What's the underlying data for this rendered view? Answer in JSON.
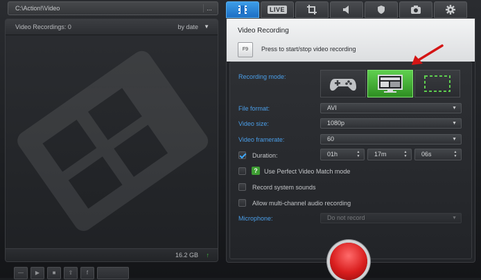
{
  "left": {
    "path": "C:\\Action!\\Video",
    "path_button": "...",
    "header_title": "Video Recordings: 0",
    "sort_label": "by date",
    "footer_size": "16.2 GB"
  },
  "tabs": [
    {
      "name": "video",
      "icon": "film-icon",
      "active": true
    },
    {
      "name": "live",
      "label": "LIVE",
      "icon": "live-icon"
    },
    {
      "name": "screenshot",
      "icon": "crop-icon"
    },
    {
      "name": "audio",
      "icon": "speaker-icon"
    },
    {
      "name": "hardware",
      "icon": "shield-icon"
    },
    {
      "name": "webcam",
      "icon": "camera-icon"
    },
    {
      "name": "settings",
      "icon": "gear-icon"
    }
  ],
  "panel": {
    "title": "Video Recording",
    "hotkey": "F9",
    "hint": "Press to start/stop video recording"
  },
  "recording": {
    "mode_label": "Recording mode:",
    "modes": [
      {
        "name": "game",
        "icon": "gamepad-icon"
      },
      {
        "name": "desktop",
        "icon": "desktop-icon",
        "selected": true
      },
      {
        "name": "region",
        "icon": "region-icon"
      }
    ],
    "file_format_label": "File format:",
    "file_format": "AVI",
    "video_size_label": "Video size:",
    "video_size": "1080p",
    "framerate_label": "Video framerate:",
    "framerate": "60",
    "duration_label": "Duration:",
    "duration_checked": true,
    "duration_h": "01h",
    "duration_m": "17m",
    "duration_s": "06s",
    "perfect_match_label": "Use Perfect Video Match mode",
    "system_sounds_label": "Record system sounds",
    "multichannel_label": "Allow multi-channel audio recording",
    "microphone_label": "Microphone:",
    "microphone": "Do not record"
  },
  "colors": {
    "accent_blue": "#4a9ee8",
    "selected_green": "#3e9e33",
    "record_red": "#d91e1e",
    "annotation_red": "#d41515"
  }
}
